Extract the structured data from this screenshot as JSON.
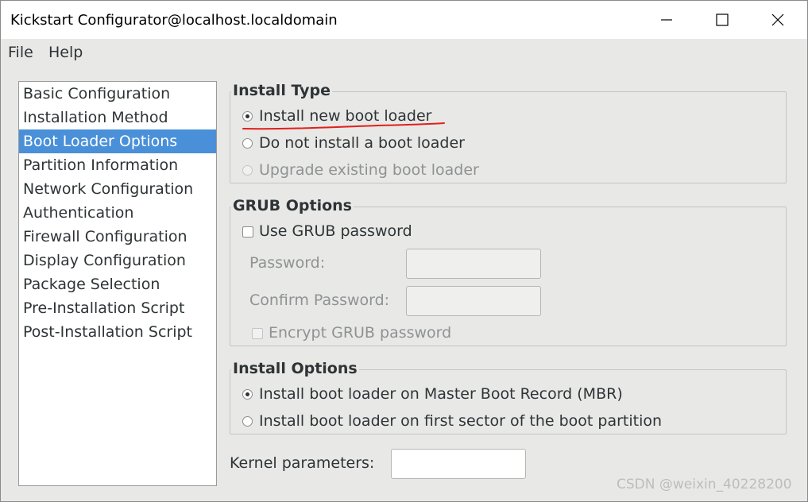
{
  "window": {
    "title": "Kickstart Configurator@localhost.localdomain"
  },
  "menubar": {
    "items": [
      "File",
      "Help"
    ]
  },
  "sidebar": {
    "items": [
      {
        "label": "Basic Configuration",
        "selected": false
      },
      {
        "label": "Installation Method",
        "selected": false
      },
      {
        "label": "Boot Loader Options",
        "selected": true
      },
      {
        "label": "Partition Information",
        "selected": false
      },
      {
        "label": "Network Configuration",
        "selected": false
      },
      {
        "label": "Authentication",
        "selected": false
      },
      {
        "label": "Firewall Configuration",
        "selected": false
      },
      {
        "label": "Display Configuration",
        "selected": false
      },
      {
        "label": "Package Selection",
        "selected": false
      },
      {
        "label": "Pre-Installation Script",
        "selected": false
      },
      {
        "label": "Post-Installation Script",
        "selected": false
      }
    ]
  },
  "install_type": {
    "title": "Install Type",
    "options": [
      {
        "label": "Install new boot loader",
        "checked": true,
        "enabled": true
      },
      {
        "label": "Do not install a boot loader",
        "checked": false,
        "enabled": true
      },
      {
        "label": "Upgrade existing boot loader",
        "checked": false,
        "enabled": false
      }
    ]
  },
  "grub_options": {
    "title": "GRUB Options",
    "use_password_label": "Use GRUB password",
    "use_password_checked": false,
    "password_label": "Password:",
    "password_value": "",
    "confirm_label": "Confirm Password:",
    "confirm_value": "",
    "encrypt_label": "Encrypt GRUB password",
    "encrypt_checked": false
  },
  "install_options": {
    "title": "Install Options",
    "options": [
      {
        "label": "Install boot loader on Master Boot Record (MBR)",
        "checked": true
      },
      {
        "label": "Install boot loader on first sector of the boot partition",
        "checked": false
      }
    ]
  },
  "kernel": {
    "label": "Kernel parameters:",
    "value": ""
  },
  "watermark": "CSDN @weixin_40228200",
  "colors": {
    "selection": "#4a90d9",
    "annotation": "#e0201b",
    "window_bg": "#e8e8e7"
  }
}
